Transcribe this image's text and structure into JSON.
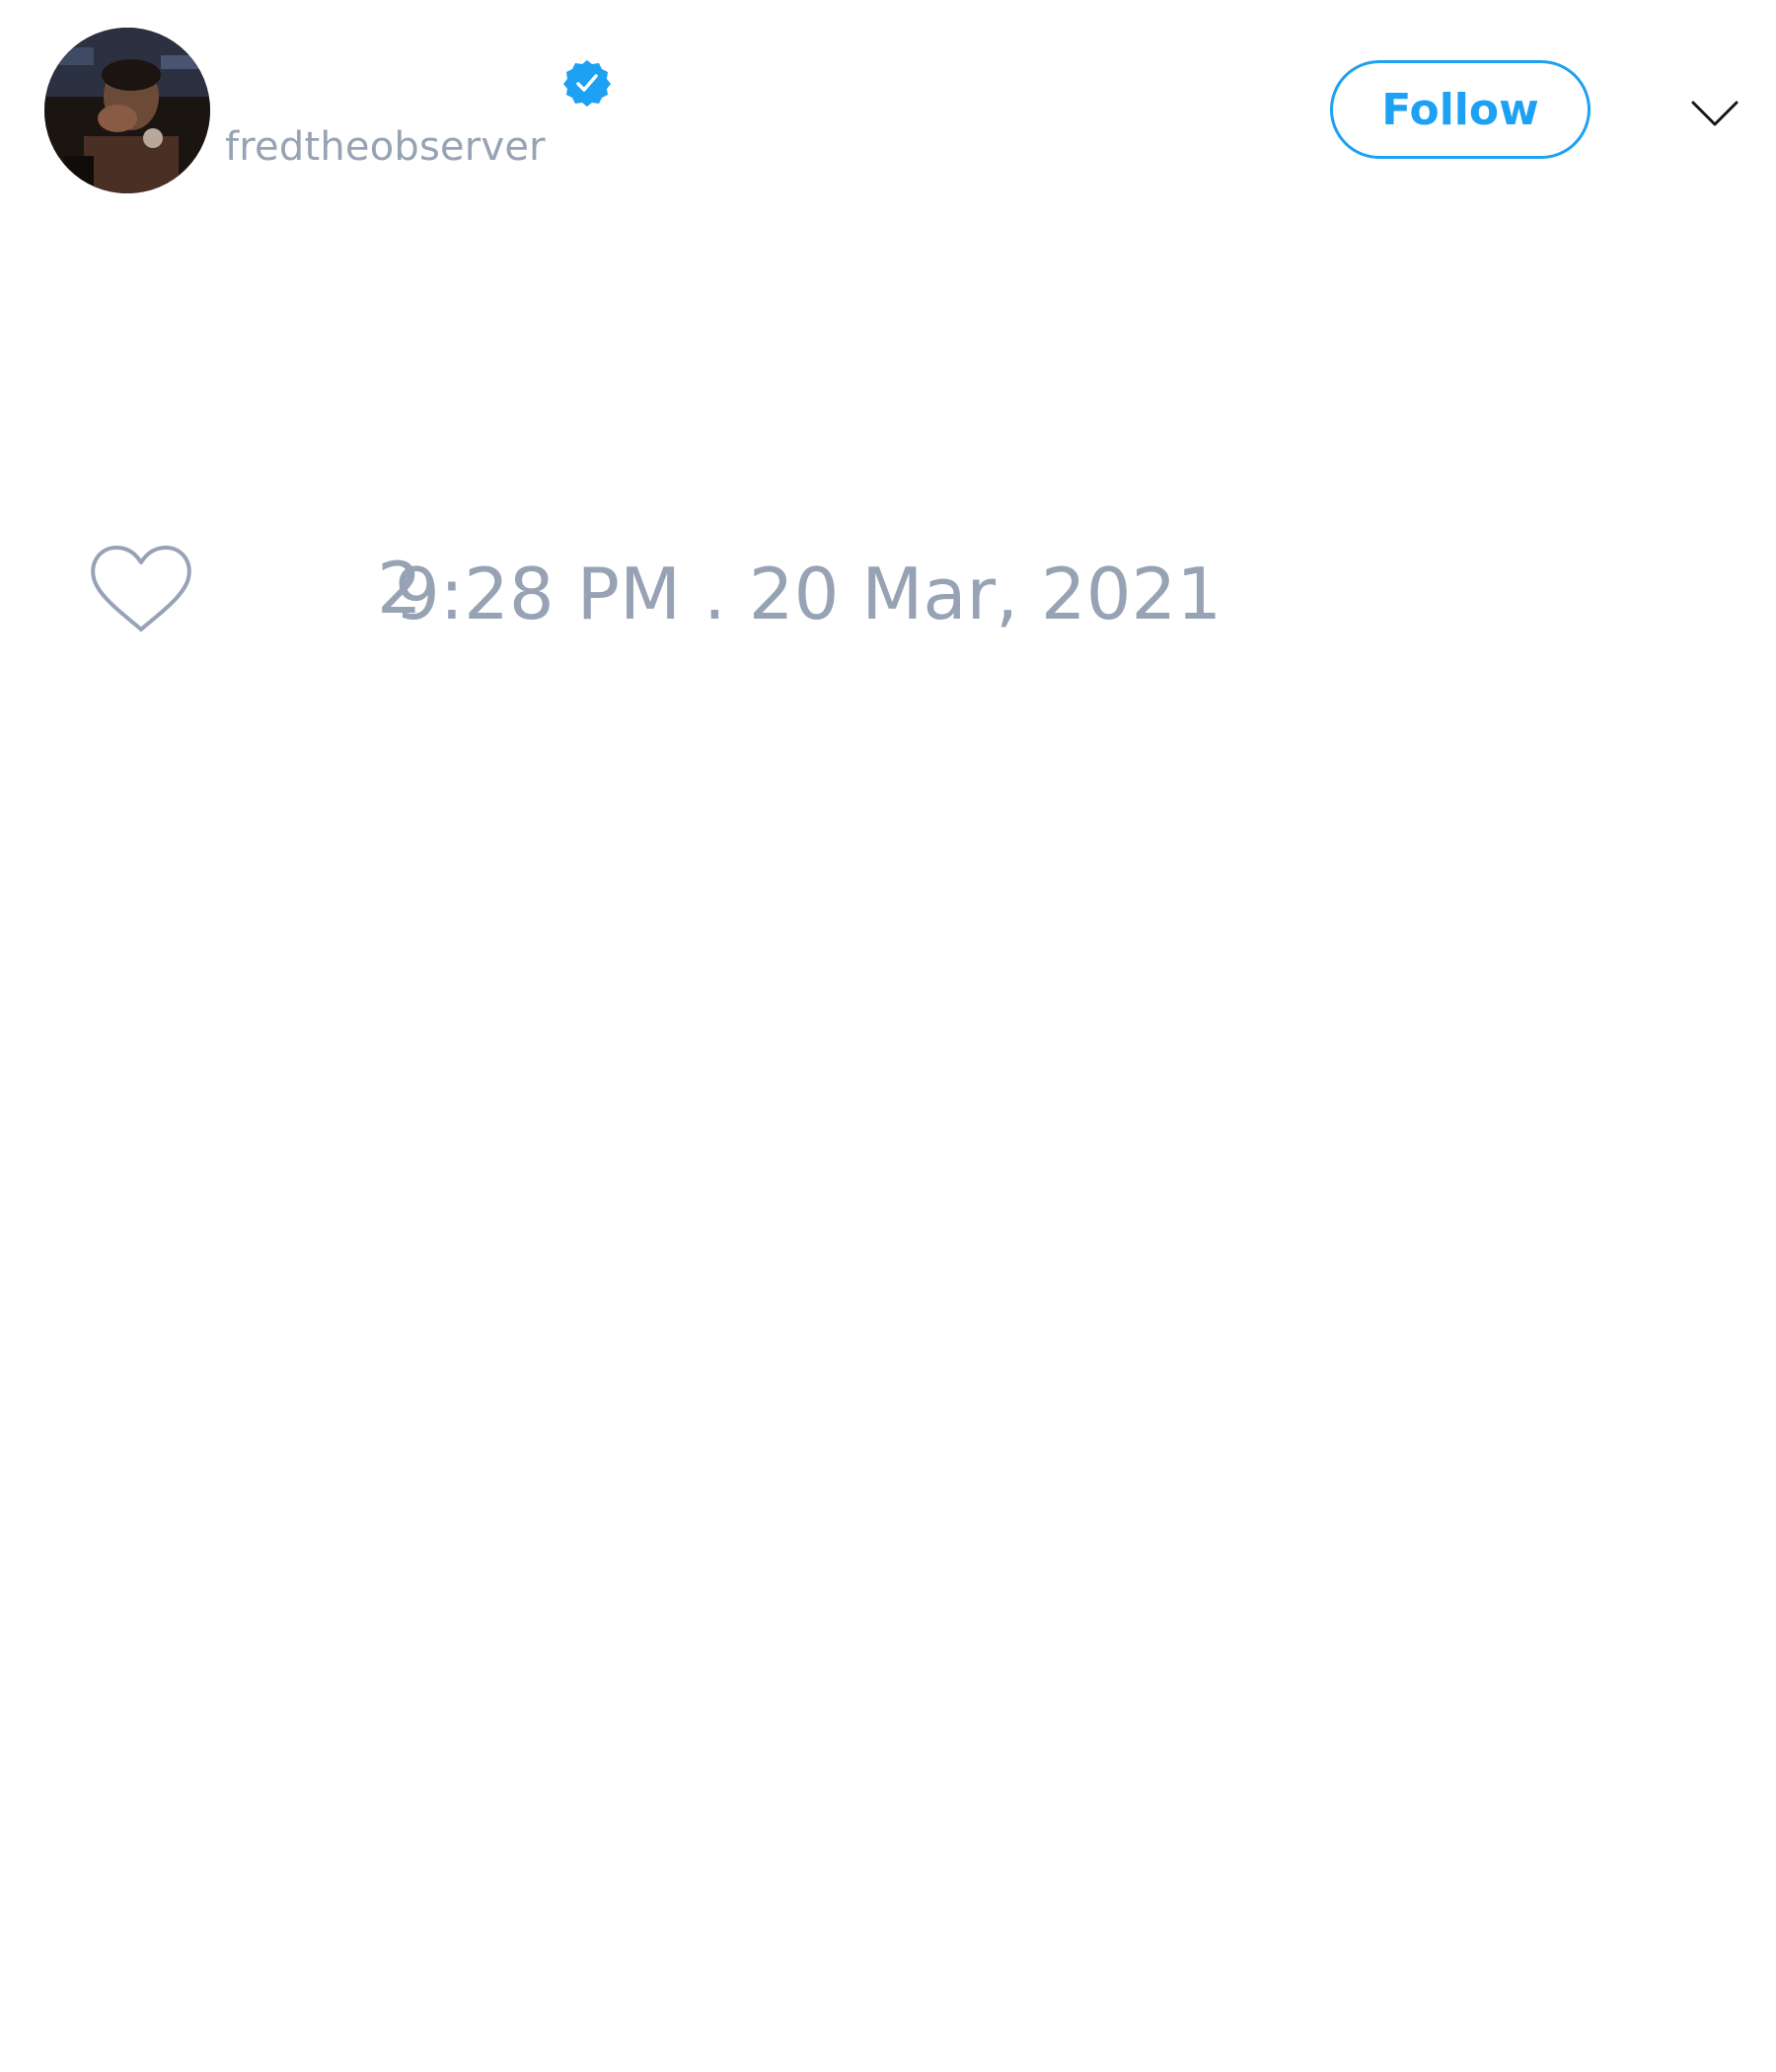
{
  "author": {
    "display_name": "",
    "handle": "fredtheobserver",
    "avatar_icon": "avatar-photo",
    "verified_icon": "verified-badge-icon"
  },
  "header": {
    "follow_label": "Follow",
    "menu_icon": "chevron-down-icon"
  },
  "tweet": {
    "text": "",
    "like_icon": "heart-icon",
    "like_count": "2",
    "timestamp": "9:28 PM . 20 Mar, 2021"
  },
  "colors": {
    "accent": "#1da1f2",
    "muted_text": "#97a3b4",
    "background": "#ffffff"
  }
}
